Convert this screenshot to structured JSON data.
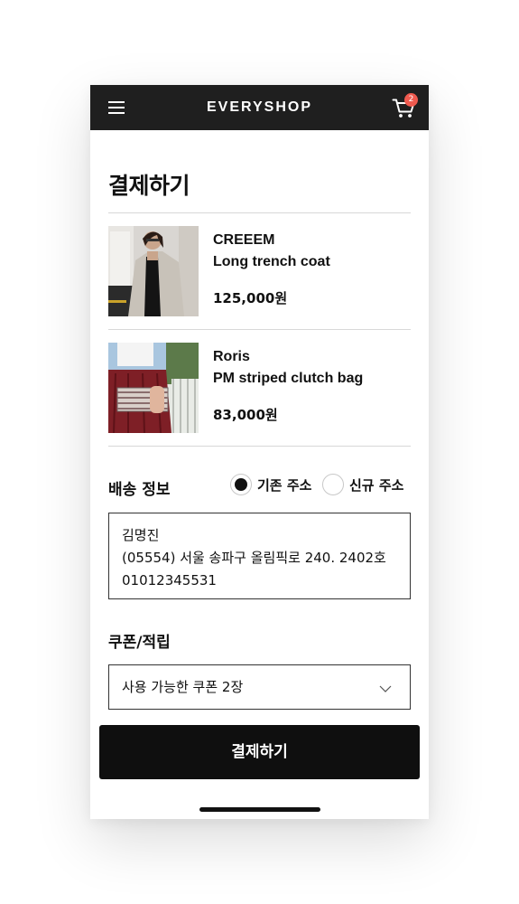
{
  "app": {
    "brand": "EVERYSHOP",
    "cart_count": "2"
  },
  "page": {
    "title": "결제하기"
  },
  "items": [
    {
      "brand": "CREEEM",
      "name": "Long trench coat",
      "price": "125,000원"
    },
    {
      "brand": "Roris",
      "name": "PM striped clutch bag",
      "price": "83,000원"
    }
  ],
  "shipping": {
    "label": "배송 정보",
    "options": [
      {
        "label": "기존 주소",
        "selected": true
      },
      {
        "label": "신규 주소",
        "selected": false
      }
    ],
    "address": {
      "name": "김명진",
      "line": "(05554) 서울 송파구 올림픽로 240. 2402호",
      "phone": "01012345531"
    }
  },
  "coupon": {
    "label": "쿠폰/적립",
    "selected": "사용 가능한 쿠폰 2장"
  },
  "actions": {
    "pay_label": "결제하기"
  },
  "colors": {
    "topbar": "#1f1f1f",
    "badge": "#ef5a4f",
    "primary_button": "#0f0f0f"
  },
  "icons": [
    "menu-icon",
    "cart-icon",
    "chevron-down-icon"
  ]
}
